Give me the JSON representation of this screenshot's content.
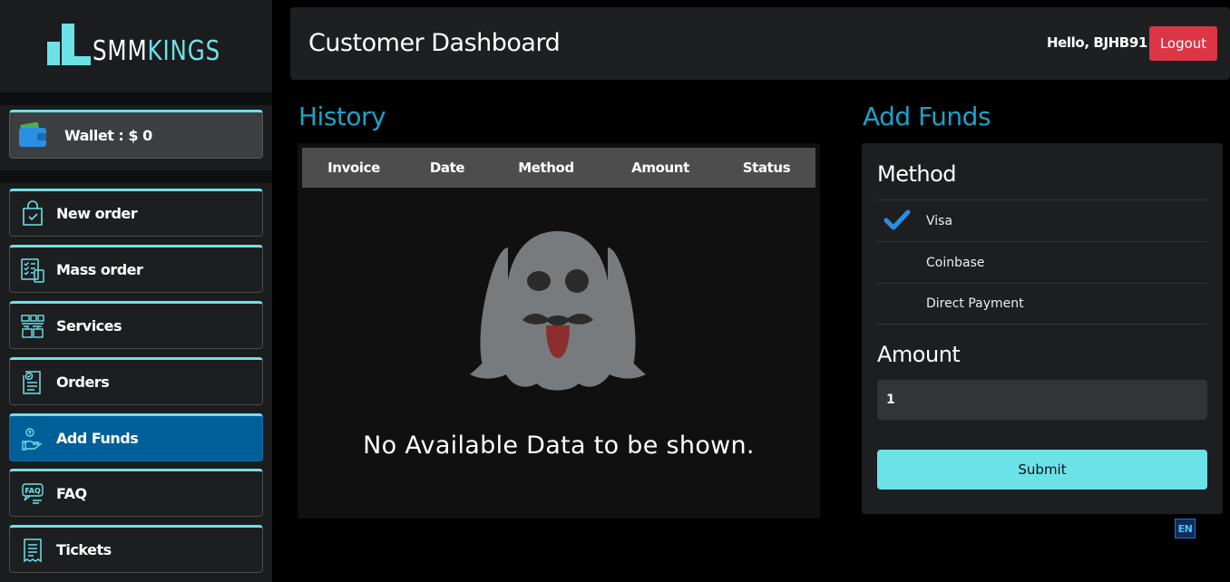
{
  "brand": {
    "logo_white": "SMM",
    "logo_cyan": "KINGS"
  },
  "wallet": {
    "label": "Wallet : $ 0"
  },
  "nav": [
    {
      "label": "New order",
      "icon": "shopping-bag-icon"
    },
    {
      "label": "Mass order",
      "icon": "checklist-icon"
    },
    {
      "label": "Services",
      "icon": "services-icon"
    },
    {
      "label": "Orders",
      "icon": "orders-icon"
    },
    {
      "label": "Add Funds",
      "icon": "add-funds-icon",
      "active": true
    },
    {
      "label": "FAQ",
      "icon": "faq-icon"
    },
    {
      "label": "Tickets",
      "icon": "tickets-icon"
    }
  ],
  "header": {
    "title": "Customer Dashboard",
    "greeting": "Hello, BJHB91",
    "logout": "Logout"
  },
  "history": {
    "title": "History",
    "columns": [
      "Invoice",
      "Date",
      "Method",
      "Amount",
      "Status"
    ],
    "empty_message": "No Available Data to be shown."
  },
  "funds": {
    "title": "Add Funds",
    "method_heading": "Method",
    "methods": [
      {
        "label": "Visa",
        "selected": true
      },
      {
        "label": "Coinbase",
        "selected": false
      },
      {
        "label": "Direct Payment",
        "selected": false
      }
    ],
    "amount_heading": "Amount",
    "amount_value": "1",
    "submit": "Submit"
  },
  "language": "EN",
  "colors": {
    "accent": "#6be2e8",
    "title_blue": "#1aa3c7",
    "active_nav": "#005f99",
    "logout_red": "#dc3545",
    "check_blue": "#2b8fe3"
  }
}
